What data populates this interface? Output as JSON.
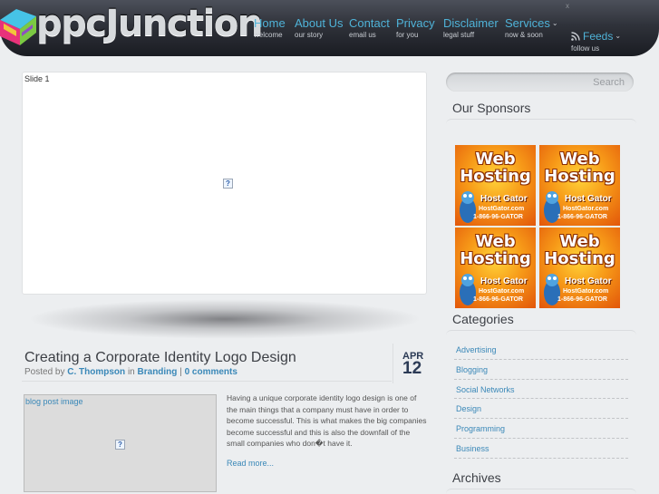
{
  "header": {
    "logo_text": "ppcJunction",
    "close_glyph": "x",
    "nav": [
      {
        "label": "Home",
        "sub": "welcome"
      },
      {
        "label": "About Us",
        "sub": "our story"
      },
      {
        "label": "Contact",
        "sub": "email us"
      },
      {
        "label": "Privacy",
        "sub": "for you"
      },
      {
        "label": "Disclaimer",
        "sub": "legal stuff"
      },
      {
        "label": "Services",
        "sub": "now & soon",
        "has_dropdown": true
      }
    ],
    "feeds": {
      "label": "Feeds",
      "sub": "follow us",
      "icon": "rss-icon"
    }
  },
  "slider": {
    "slide_label": "Slide 1",
    "image_icon": "broken-image-icon"
  },
  "post": {
    "title": "Creating a Corporate Identity Logo Design",
    "posted_by": "Posted by",
    "author": "C. Thompson",
    "in": "in",
    "category": "Branding",
    "divider": "|",
    "comments": "0 comments",
    "date_month": "APR",
    "date_day": "12",
    "image_label": "blog post image",
    "excerpt": "Having a unique corporate identity logo design is one of the main things that a company must have in order to become successful. This is what makes the big companies become successful and this is also the downfall of the small companies who don�t have it.",
    "read_more": "Read more..."
  },
  "sidebar": {
    "search_placeholder": "Search",
    "sponsors_title": "Our Sponsors",
    "ads": [
      {
        "line1": "Web",
        "line2": "Hosting",
        "brand": "Host Gator",
        "site": "HostGator.com",
        "phone": "1-866-96-GATOR"
      },
      {
        "line1": "Web",
        "line2": "Hosting",
        "brand": "Host Gator",
        "site": "HostGator.com",
        "phone": "1-866-96-GATOR"
      },
      {
        "line1": "Web",
        "line2": "Hosting",
        "brand": "Host Gator",
        "site": "HostGator.com",
        "phone": "1-866-96-GATOR"
      },
      {
        "line1": "Web",
        "line2": "Hosting",
        "brand": "Host Gator",
        "site": "HostGator.com",
        "phone": "1-866-96-GATOR"
      }
    ],
    "categories_title": "Categories",
    "categories": [
      "Advertising",
      "Blogging",
      "Social Networks",
      "Design",
      "Programming",
      "Business"
    ],
    "archives_title": "Archives"
  },
  "colors": {
    "link_blue": "#4fb3d8",
    "content_link": "#3a88b8",
    "header_dark": "#2f323a",
    "ad_orange": "#f79a18"
  }
}
